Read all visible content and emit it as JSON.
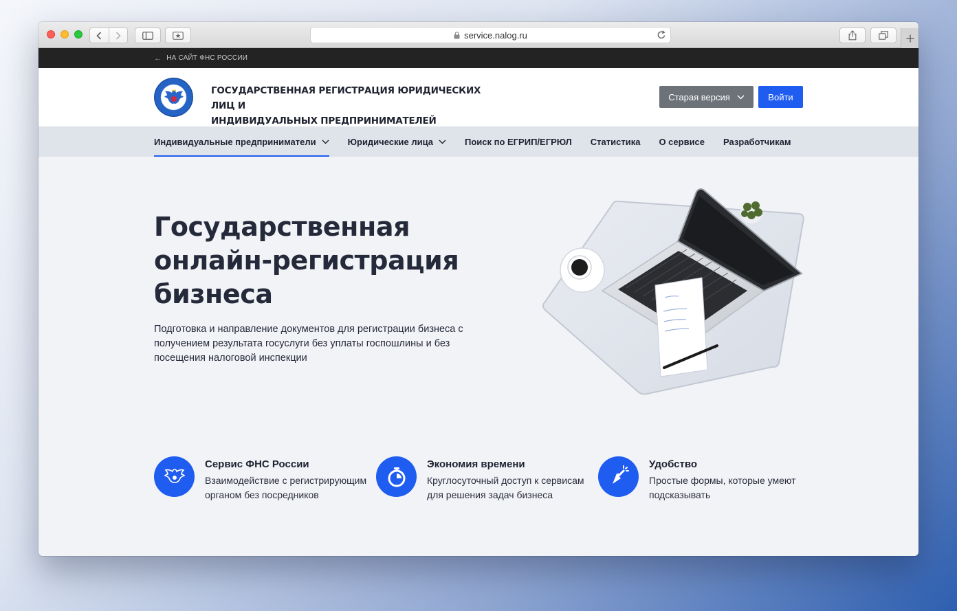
{
  "browser": {
    "url": "service.nalog.ru"
  },
  "topbar": {
    "back_link": "НА САЙТ ФНС РОССИИ"
  },
  "header": {
    "title_line1": "ГОСУДАРСТВЕННАЯ РЕГИСТРАЦИЯ ЮРИДИЧЕСКИХ ЛИЦ И",
    "title_line2": "ИНДИВИДУАЛЬНЫХ ПРЕДПРИНИМАТЕЛЕЙ",
    "old_version_label": "Старая версия",
    "login_label": "Войти"
  },
  "menu": {
    "items": [
      {
        "label": "Индивидуальные предприниматели",
        "dropdown": true,
        "active": true
      },
      {
        "label": "Юридические лица",
        "dropdown": true,
        "active": false
      },
      {
        "label": "Поиск по ЕГРИП/ЕГРЮЛ",
        "dropdown": false,
        "active": false
      },
      {
        "label": "Статистика",
        "dropdown": false,
        "active": false
      },
      {
        "label": "О сервисе",
        "dropdown": false,
        "active": false
      },
      {
        "label": "Разработчикам",
        "dropdown": false,
        "active": false
      }
    ]
  },
  "hero": {
    "title_line1": "Государственная",
    "title_line2": "онлайн-регистрация",
    "title_line3": "бизнеса",
    "subtitle": "Подготовка и направление документов для регистрации бизнеса с получением результата госуслуги без уплаты госпошлины и без посещения налоговой инспекции"
  },
  "features": [
    {
      "icon": "eagle-icon",
      "title": "Сервис ФНС России",
      "description": "Взаимодействие с регистрирующим органом без посредников"
    },
    {
      "icon": "stopwatch-icon",
      "title": "Экономия времени",
      "description": "Круглосуточный доступ к сервисам для решения задач бизнеса"
    },
    {
      "icon": "cursor-click-icon",
      "title": "Удобство",
      "description": "Простые формы, которые умеют подсказывать"
    }
  ],
  "colors": {
    "accent": "#1f5cf0",
    "topbar": "#232323",
    "menu_bg": "#dfe3ea",
    "page_bg": "#f2f3f7",
    "old_version_btn": "#6d7279"
  }
}
